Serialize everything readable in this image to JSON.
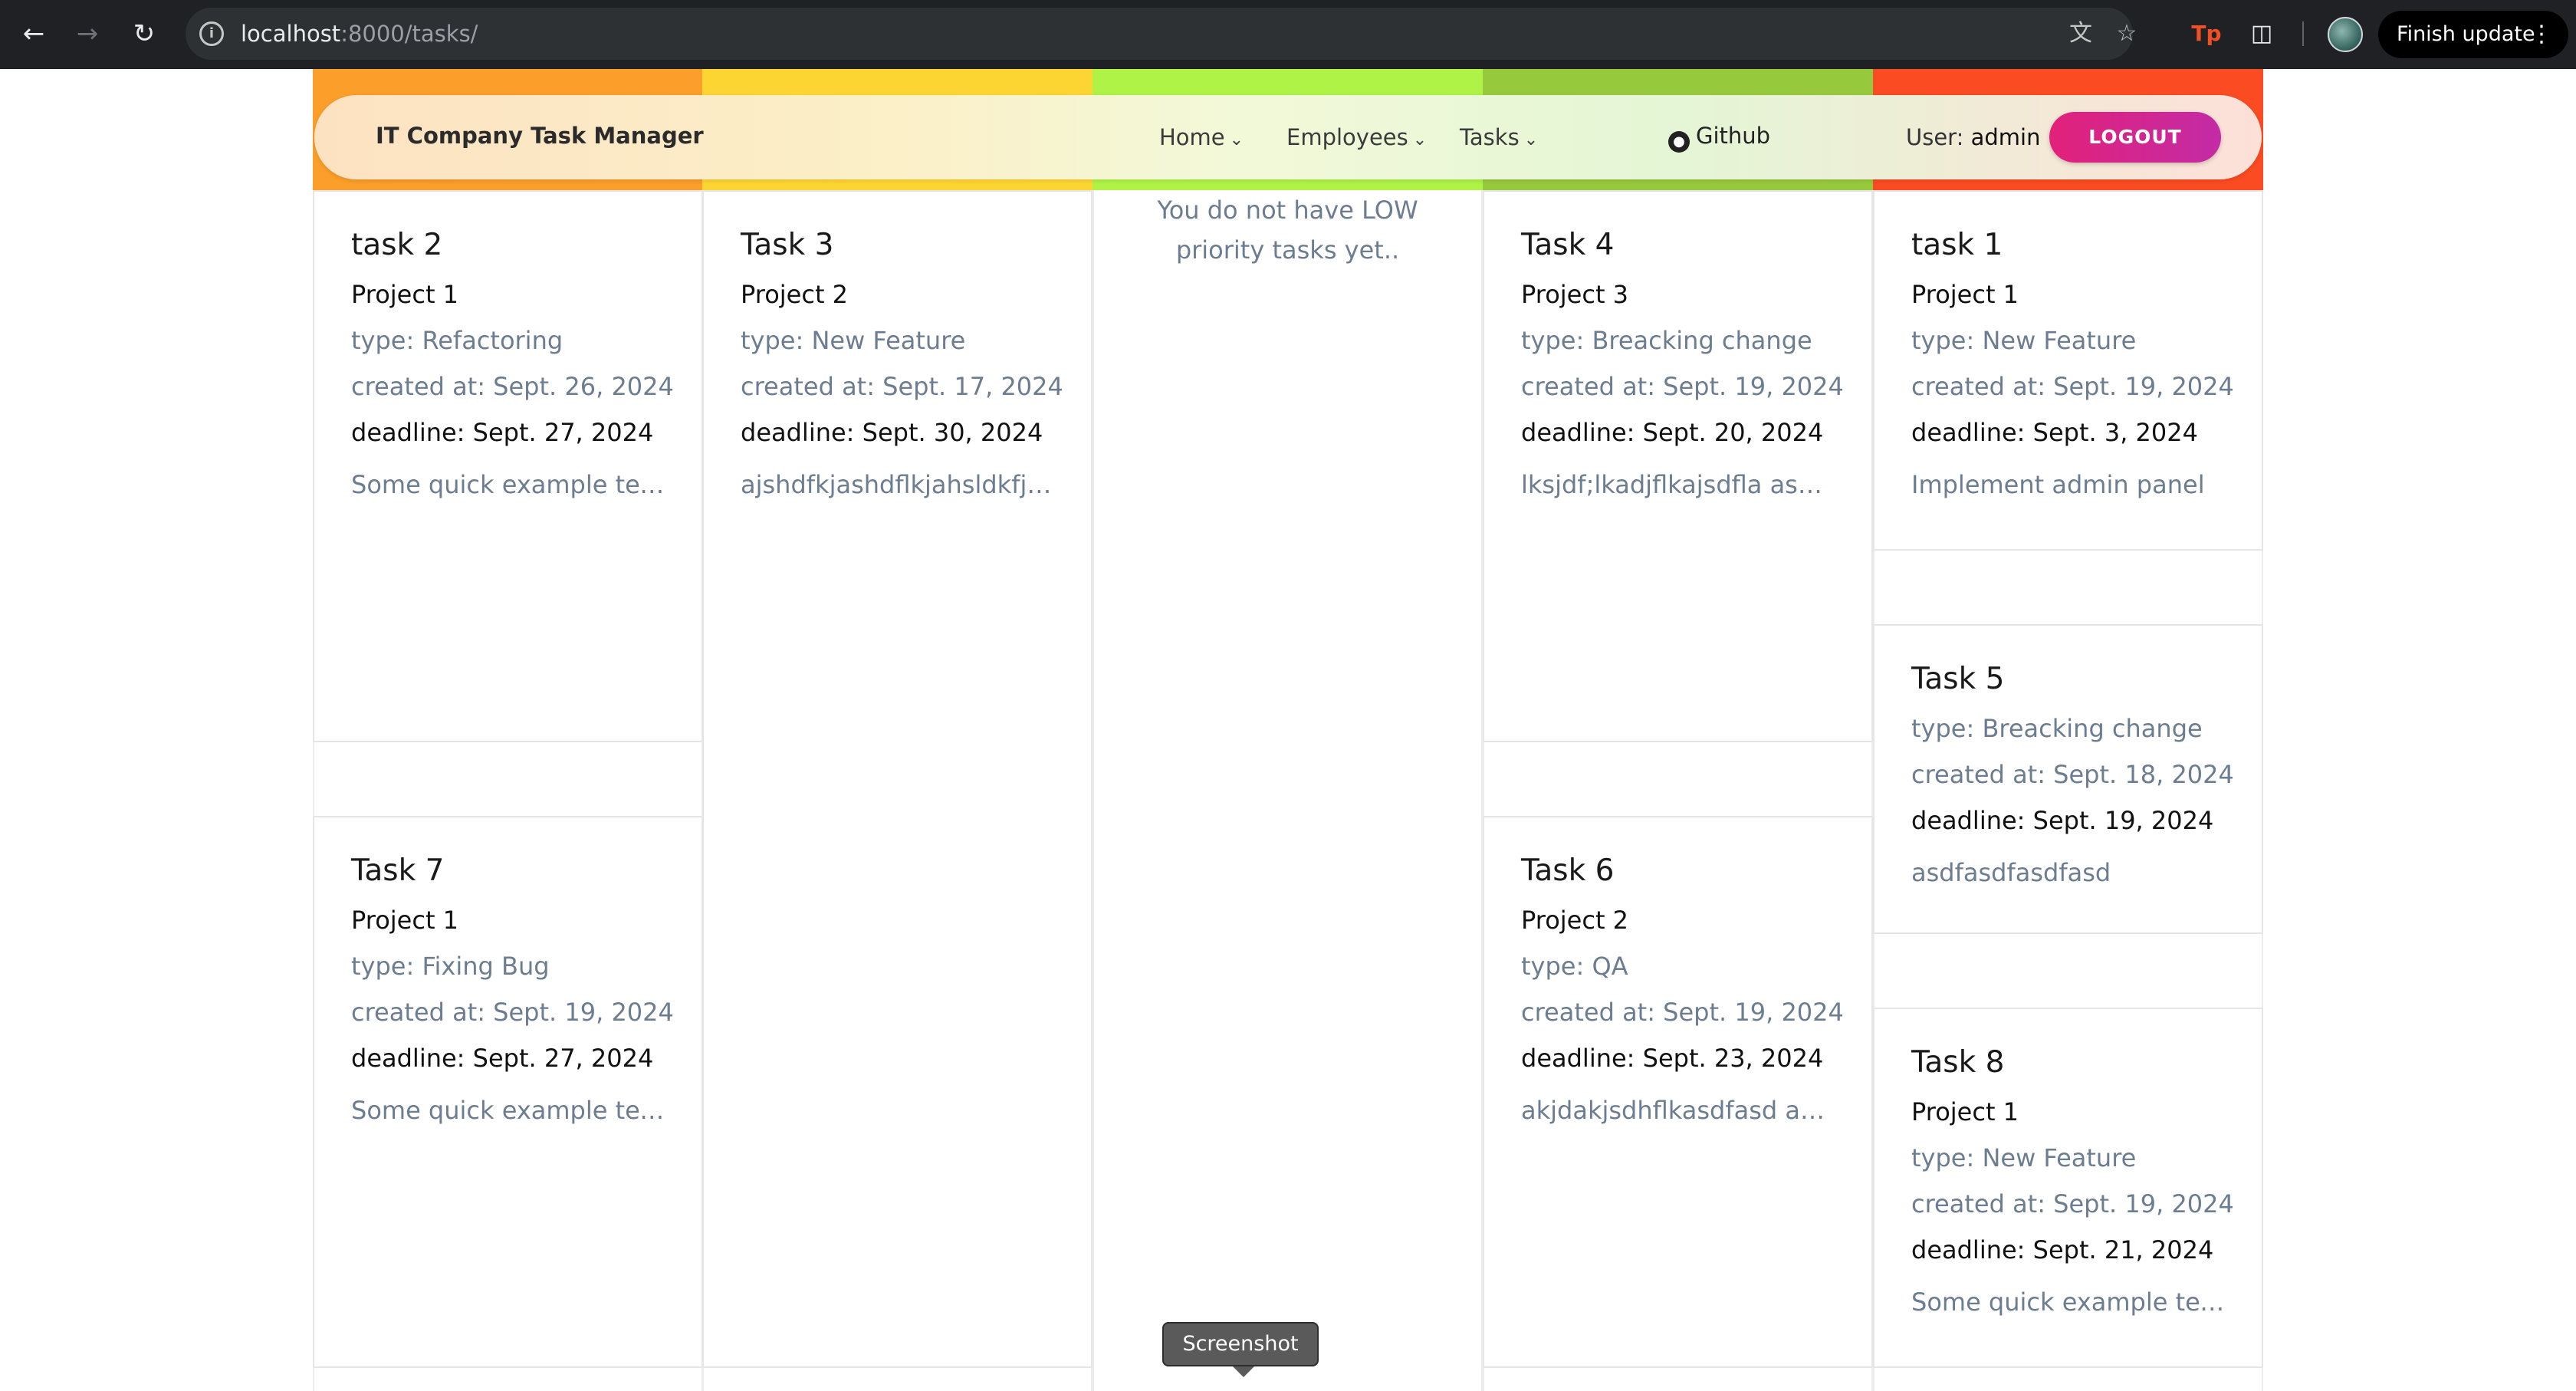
{
  "browser": {
    "url_host": "localhost",
    "url_path": ":8000/tasks/",
    "finish_update_label": "Finish update",
    "extension_label": "Tp"
  },
  "navbar": {
    "brand": "IT Company Task Manager",
    "links": [
      {
        "label": "Home"
      },
      {
        "label": "Employees"
      },
      {
        "label": "Tasks"
      }
    ],
    "github_label": "Github",
    "user_prefix": "User: ",
    "username": "admin",
    "logout_label": "LOGOUT"
  },
  "columns": {
    "colors": [
      "#fb9e2a",
      "#fdd532",
      "#aef346",
      "#97c93d",
      "#fa4b22"
    ],
    "empty_message": "You do not have LOW priority tasks yet.."
  },
  "cards": [
    {
      "title": "task 2",
      "project": "Project 1",
      "type": "type: Refactoring",
      "created": "created at: Sept. 26, 2024",
      "deadline": "deadline: Sept. 27, 2024",
      "desc": "Some quick example text ..."
    },
    {
      "title": "Task 7",
      "project": "Project 1",
      "type": "type: Fixing Bug",
      "created": "created at: Sept. 19, 2024",
      "deadline": "deadline: Sept. 27, 2024",
      "desc": "Some quick example text ..."
    },
    {
      "title": "Task 3",
      "project": "Project 2",
      "type": "type: New Feature",
      "created": "created at: Sept. 17, 2024",
      "deadline": "deadline: Sept. 30, 2024",
      "desc": "ajshdfkjashdflkjahsldkfjh..."
    },
    {
      "title": "Task 4",
      "project": "Project 3",
      "type": "type: Breacking change",
      "created": "created at: Sept. 19, 2024",
      "deadline": "deadline: Sept. 20, 2024",
      "desc": "lksjdf;lkadjflkajsdfla asdlk..."
    },
    {
      "title": "Task 6",
      "project": "Project 2",
      "type": "type: QA",
      "created": "created at: Sept. 19, 2024",
      "deadline": "deadline: Sept. 23, 2024",
      "desc": "akjdakjsdhflkasdfasd as d..."
    },
    {
      "title": "task 1",
      "project": "Project 1",
      "type": "type: New Feature",
      "created": "created at: Sept. 19, 2024",
      "deadline": "deadline: Sept. 3, 2024",
      "desc": "Implement admin panel"
    },
    {
      "title": "Task 5",
      "type": "type: Breacking change",
      "created": "created at: Sept. 18, 2024",
      "deadline": "deadline: Sept. 19, 2024",
      "desc": "asdfasdfasdfasd"
    },
    {
      "title": "Task 8",
      "project": "Project 1",
      "type": "type: New Feature",
      "created": "created at: Sept. 19, 2024",
      "deadline": "deadline: Sept. 21, 2024",
      "desc": "Some quick example text ..."
    }
  ],
  "tooltip": "Screenshot"
}
